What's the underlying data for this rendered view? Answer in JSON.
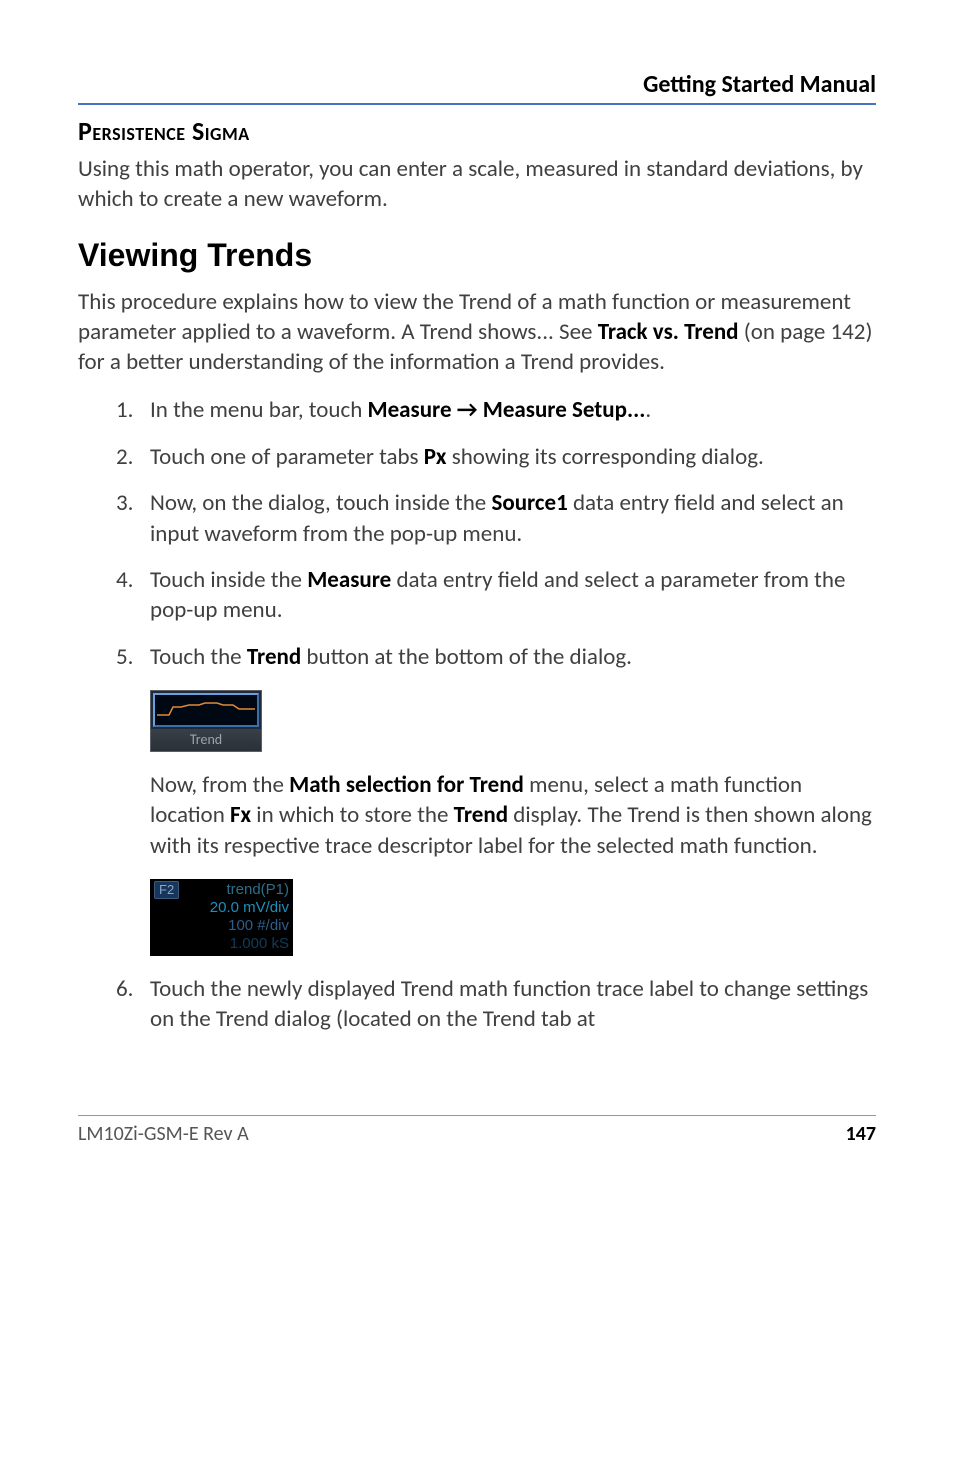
{
  "header": {
    "title": "Getting Started Manual"
  },
  "section1": {
    "heading": "Persistence Sigma",
    "para": "Using this math operator, you can enter a scale, measured in standard deviations, by which to create a new waveform."
  },
  "section2": {
    "heading": "Viewing Trends",
    "intro_pre": "This procedure explains how to view the Trend of a math function or measurement parameter applied to a waveform. A Trend shows... See ",
    "intro_bold": "Track vs. Trend",
    "intro_post": " (on page 142) for a better understanding of the information a Trend provides.",
    "steps": {
      "s1": {
        "pre": "In the menu bar, touch ",
        "bold": "Measure → Measure Setup...",
        "post": "."
      },
      "s2": {
        "pre": "Touch one of parameter tabs ",
        "bold": "Px",
        "post": " showing its corresponding dialog."
      },
      "s3": {
        "pre": "Now, on the dialog, touch inside the ",
        "bold": "Source1",
        "post": " data entry field and select an input waveform from the pop-up menu."
      },
      "s4": {
        "pre": "Touch inside the ",
        "bold": "Measure",
        "post": " data entry field and select a parameter from the pop-up menu."
      },
      "s5": {
        "pre": "Touch the ",
        "bold": "Trend",
        "post": " button at the bottom of the dialog."
      },
      "s6": {
        "text": "Touch the newly displayed Trend math function trace label to change settings on the Trend dialog (located on the Trend tab at"
      }
    },
    "trend_button_label": "Trend",
    "after_button": {
      "p1_pre": "Now, from the ",
      "p1_b1": "Math selection for Trend",
      "p1_mid1": " menu, select a math function location ",
      "p1_b2": "Fx",
      "p1_mid2": " in which to store the ",
      "p1_b3": "Trend",
      "p1_post": " display. The Trend is then shown along with its respective trace descriptor label for the selected math function."
    },
    "trace_descriptor": {
      "badge": "F2",
      "fname": "trend(P1)",
      "line2": "20.0 mV/div",
      "line3": "100 #/div",
      "line4": "1.000 kS"
    }
  },
  "footer": {
    "left": "LM10Zi-GSM-E Rev A",
    "page": "147"
  }
}
